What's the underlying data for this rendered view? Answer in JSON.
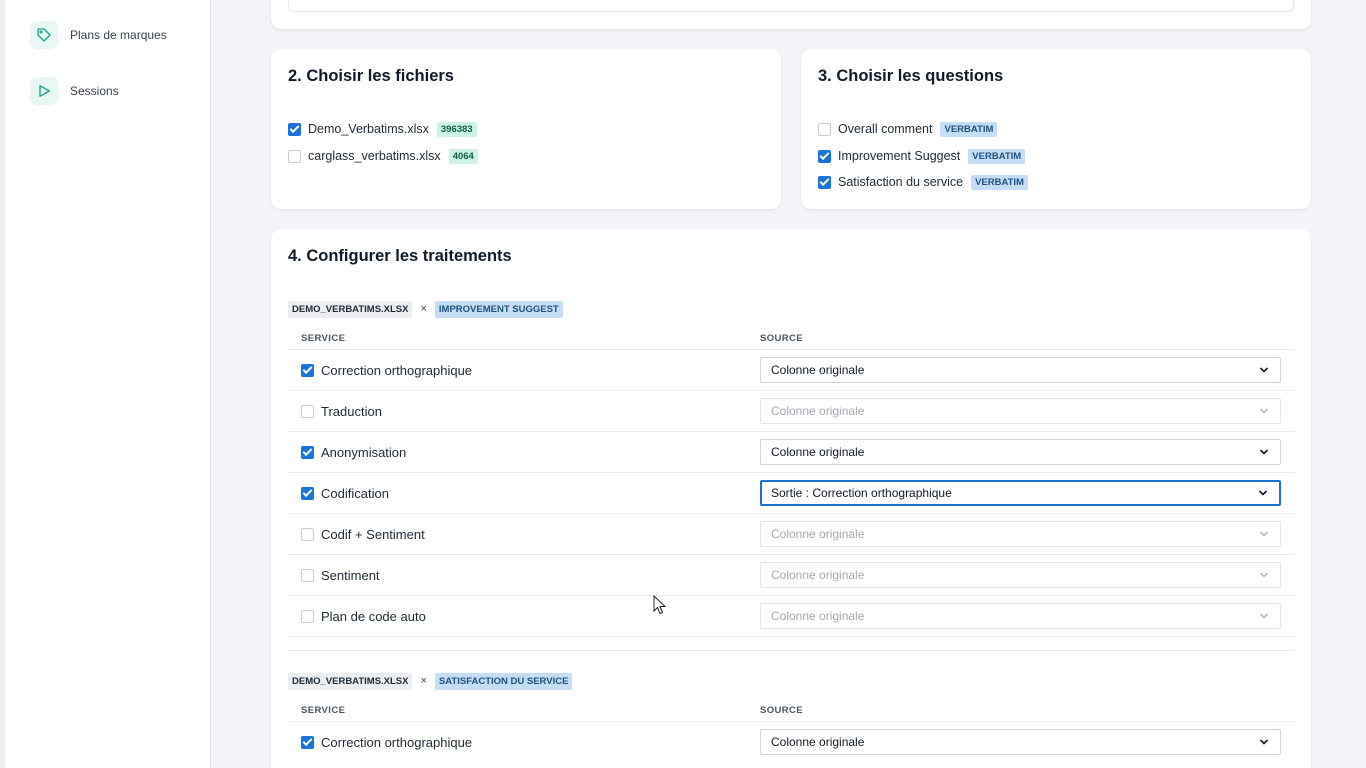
{
  "sidebar": {
    "items": [
      {
        "label": "Plans de marques",
        "icon": "tag-icon"
      },
      {
        "label": "Sessions",
        "icon": "play-icon"
      }
    ]
  },
  "files_section": {
    "title": "2. Choisir les fichiers",
    "files": [
      {
        "name": "Demo_Verbatims.xlsx",
        "count": "396383",
        "checked": true
      },
      {
        "name": "carglass_verbatims.xlsx",
        "count": "4064",
        "checked": false
      }
    ]
  },
  "questions_section": {
    "title": "3. Choisir les questions",
    "questions": [
      {
        "name": "Overall comment",
        "type": "VERBATIM",
        "checked": false
      },
      {
        "name": "Improvement Suggest",
        "type": "VERBATIM",
        "checked": true
      },
      {
        "name": "Satisfaction du service",
        "type": "VERBATIM",
        "checked": true
      }
    ]
  },
  "config_section": {
    "title": "4. Configurer les traitements",
    "col_service": "SERVICE",
    "col_source": "SOURCE",
    "times_symbol": "×",
    "combos": [
      {
        "file": "DEMO_VERBATIMS.XLSX",
        "question": "IMPROVEMENT SUGGEST",
        "services": [
          {
            "label": "Correction orthographique",
            "checked": true,
            "source": "Colonne originale"
          },
          {
            "label": "Traduction",
            "checked": false,
            "source": "Colonne originale"
          },
          {
            "label": "Anonymisation",
            "checked": true,
            "source": "Colonne originale"
          },
          {
            "label": "Codification",
            "checked": true,
            "source": "Sortie : Correction orthographique"
          },
          {
            "label": "Codif + Sentiment",
            "checked": false,
            "source": "Colonne originale"
          },
          {
            "label": "Sentiment",
            "checked": false,
            "source": "Colonne originale"
          },
          {
            "label": "Plan de code auto",
            "checked": false,
            "source": "Colonne originale"
          }
        ]
      },
      {
        "file": "DEMO_VERBATIMS.XLSX",
        "question": "SATISFACTION DU SERVICE",
        "services": [
          {
            "label": "Correction orthographique",
            "checked": true,
            "source": "Colonne originale"
          }
        ]
      }
    ]
  },
  "colors": {
    "accent": "#1a73d9",
    "badge_green": "#cdf3e6",
    "badge_blue": "#c6def5",
    "icon_teal": "#1aa389"
  }
}
